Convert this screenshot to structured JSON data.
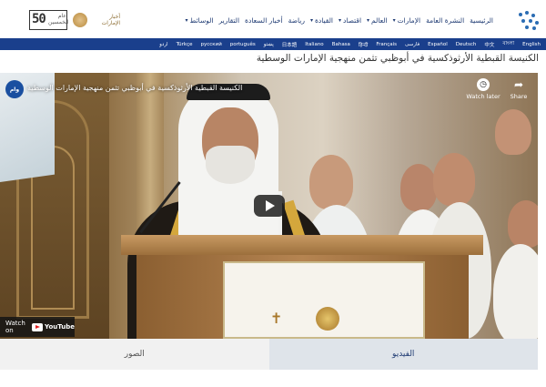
{
  "header": {
    "logo_left_number": "50",
    "logo_left_text": "عام الخمسين",
    "logo_right_text": "أخبار الإمارات",
    "nav": [
      {
        "label": "الرئيسية",
        "dropdown": false
      },
      {
        "label": "النشرة العامة",
        "dropdown": false
      },
      {
        "label": "الإمارات",
        "dropdown": true
      },
      {
        "label": "العالم",
        "dropdown": true
      },
      {
        "label": "اقتصاد",
        "dropdown": true
      },
      {
        "label": "القيادة",
        "dropdown": true
      },
      {
        "label": "رياضة",
        "dropdown": false
      },
      {
        "label": "أخبار السعادة",
        "dropdown": false
      },
      {
        "label": "التقارير",
        "dropdown": false
      },
      {
        "label": "الوسائط",
        "dropdown": true
      }
    ]
  },
  "languages": [
    "English",
    "বাংলা",
    "中文",
    "Deutsch",
    "Español",
    "فارسی",
    "Français",
    "हिन्दी",
    "Bahasa",
    "Italiano",
    "日本語",
    "پښتو",
    "português",
    "русский",
    "Türkçe",
    "اردو"
  ],
  "headline": "الكنيسة القبطية الأرثوذكسية في أبوظبي تثمن منهجية الإمارات الوسطية",
  "video": {
    "channel_badge": "وام",
    "title": "الكنيسة القبطية الأرثوذكسية في أبوظبي تثمن منهجية الإمارات الوسطية",
    "watch_later": "Watch later",
    "share": "Share",
    "watch_on": "Watch on",
    "youtube": "YouTube"
  },
  "tabs": {
    "photos": "الصور",
    "video": "الفيديو"
  },
  "colors": {
    "nav_text": "#1f3b73",
    "lang_bar": "#1a3f8c",
    "tab_active": "#dfe4ea"
  }
}
